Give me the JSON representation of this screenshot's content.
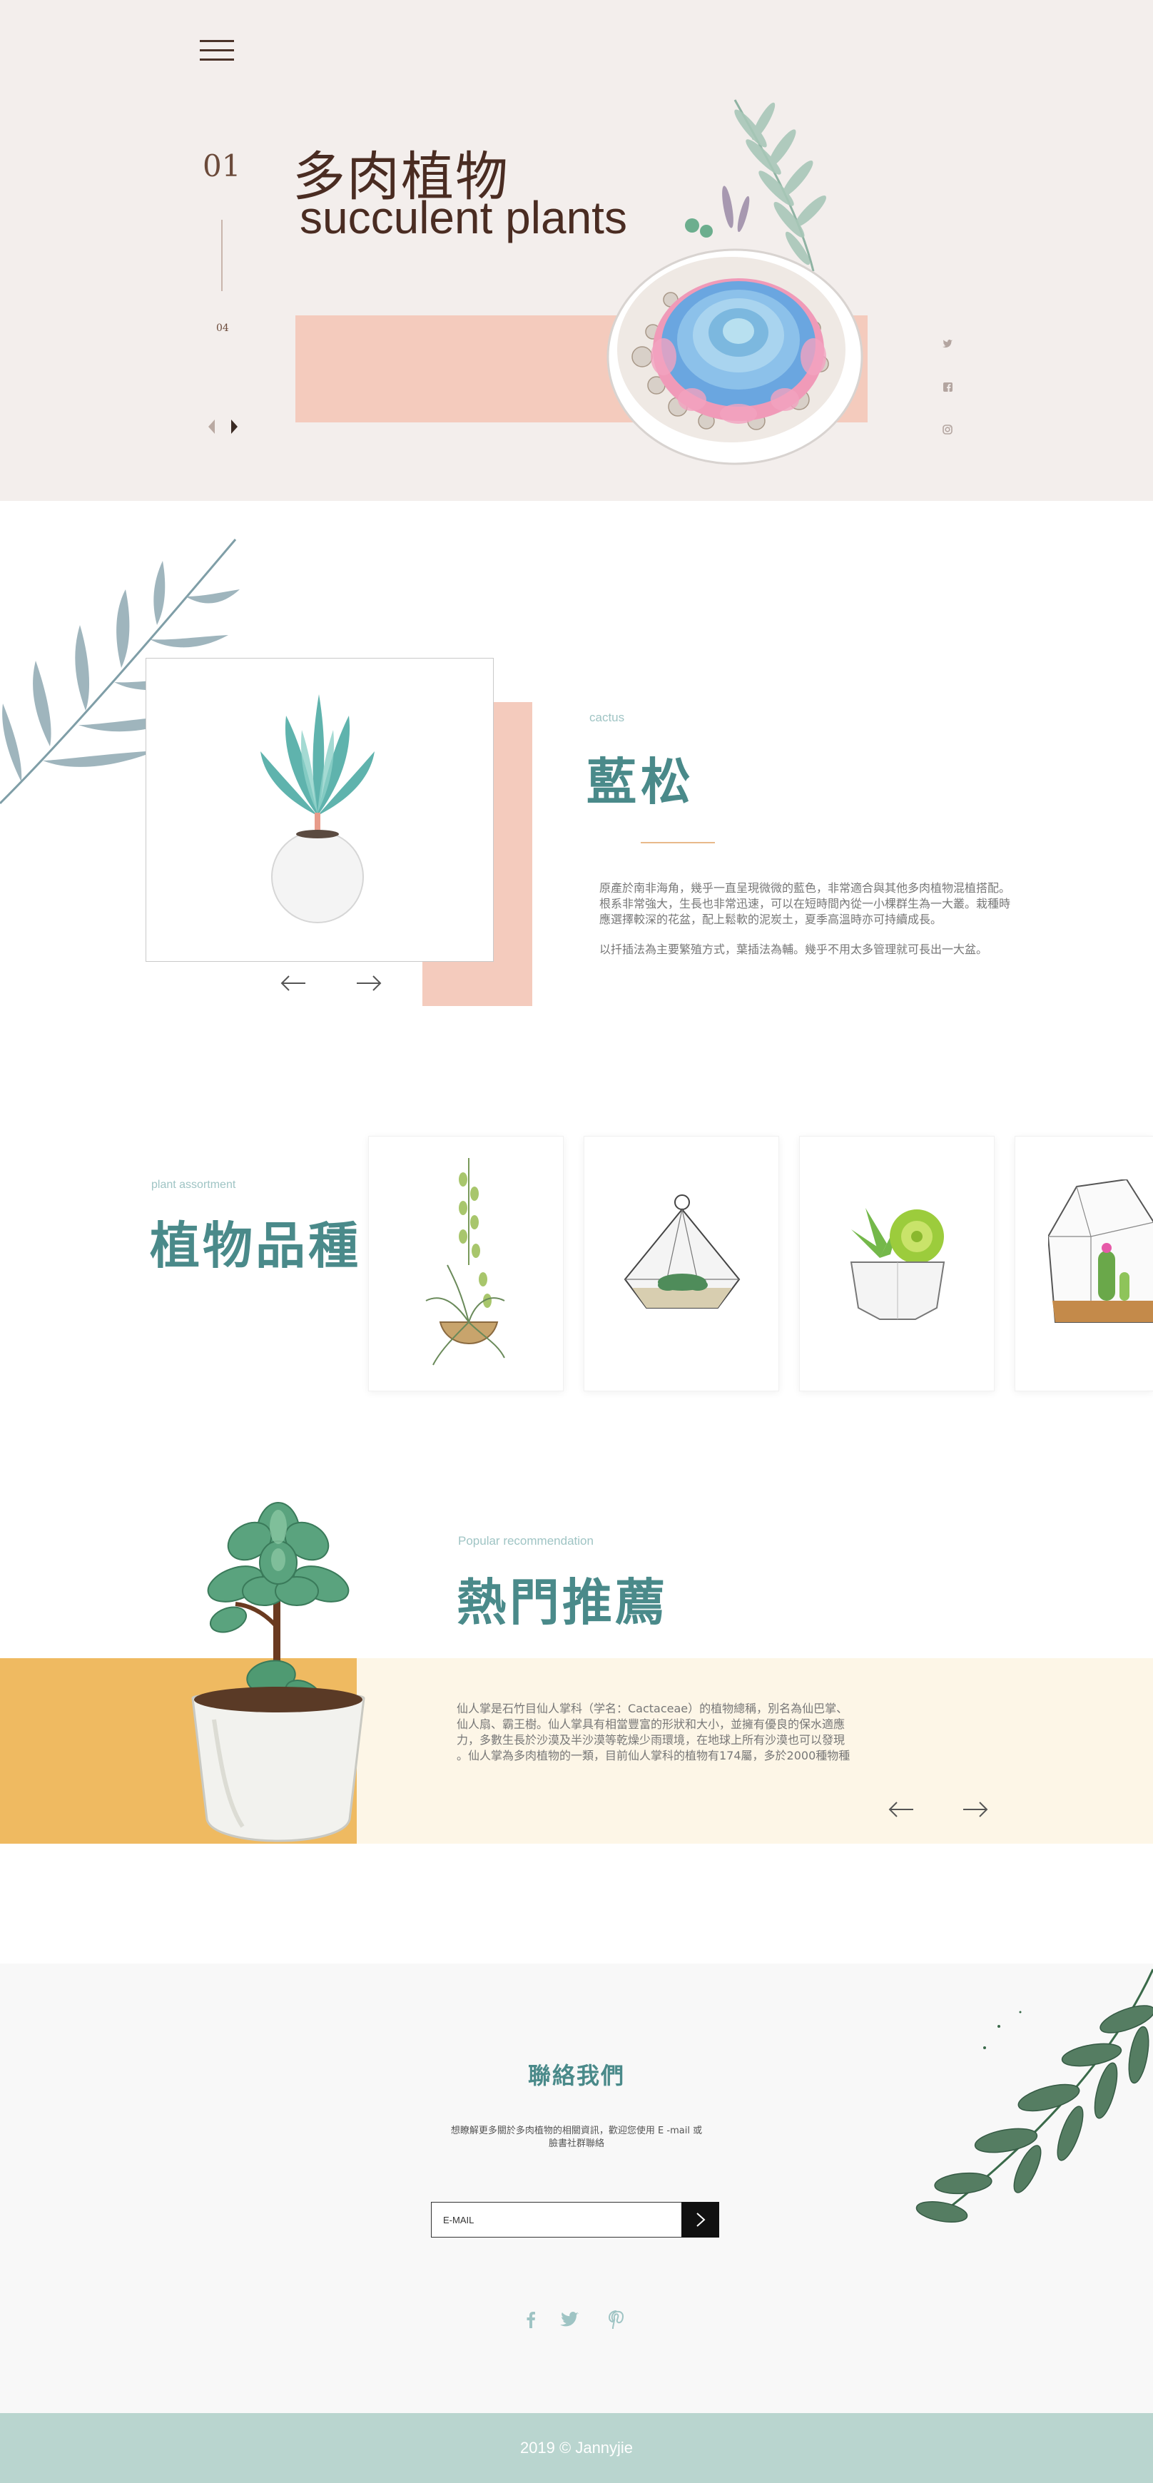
{
  "hero": {
    "slide_current": "01",
    "slide_total": "04",
    "title_zh": "多肉植物",
    "title_en": "succulent plants",
    "social": [
      "twitter-icon",
      "facebook-icon",
      "instagram-icon"
    ]
  },
  "cactus": {
    "small_label": "cactus",
    "title": "藍松",
    "paragraph1_line1": "原產於南非海角，幾乎一直呈現微微的藍色，非常適合與其他多肉植物混植搭配。",
    "paragraph1_line2": "根系非常強大，生長也非常迅速，可以在短時間內從一小棵群生為一大叢。栽種時",
    "paragraph1_line3": "應選擇較深的花盆，配上鬆軟的泥炭土，夏季高溫時亦可持續成長。",
    "paragraph2": "以扦插法為主要繁殖方式，葉插法為輔。幾乎不用太多管理就可長出一大盆。"
  },
  "assortment": {
    "small_label": "plant assortment",
    "title": "植物品種",
    "cards": [
      "hanging-air-plant",
      "geometric-terrarium",
      "potted-succulent",
      "cactus-terrarium"
    ]
  },
  "popular": {
    "small_label": "Popular recommendation",
    "title": "熱門推薦",
    "line1": "仙人掌是石竹目仙人掌科（学名：Cactaceae）的植物總稱，別名為仙巴掌、",
    "line2": "仙人扇、霸王樹。仙人掌具有相當豐富的形狀和大小，並擁有優良的保水適應",
    "line3": "力，多數生長於沙漠及半沙漠等乾燥少雨環境，在地球上所有沙漠也可以發現",
    "line4": "。仙人掌為多肉植物的一類，目前仙人掌科的植物有174屬，多於2000種物種"
  },
  "contact": {
    "title": "聯絡我們",
    "line1": "想瞭解更多關於多肉植物的相關資訊，歡迎您使用 E -mail 或",
    "line2": "臉書社群聯絡",
    "email_placeholder": "E-MAIL",
    "social": [
      "facebook-icon",
      "twitter-icon",
      "pinterest-icon"
    ]
  },
  "footer": {
    "copyright": "2019 © Jannyjie"
  },
  "colors": {
    "hero_bg": "#f3eeec",
    "pink": "#f4cbbd",
    "teal": "#4a8a8a",
    "orange": "#efba61",
    "cream": "#fdf6e7",
    "footer_bg": "#b9d5cf"
  }
}
